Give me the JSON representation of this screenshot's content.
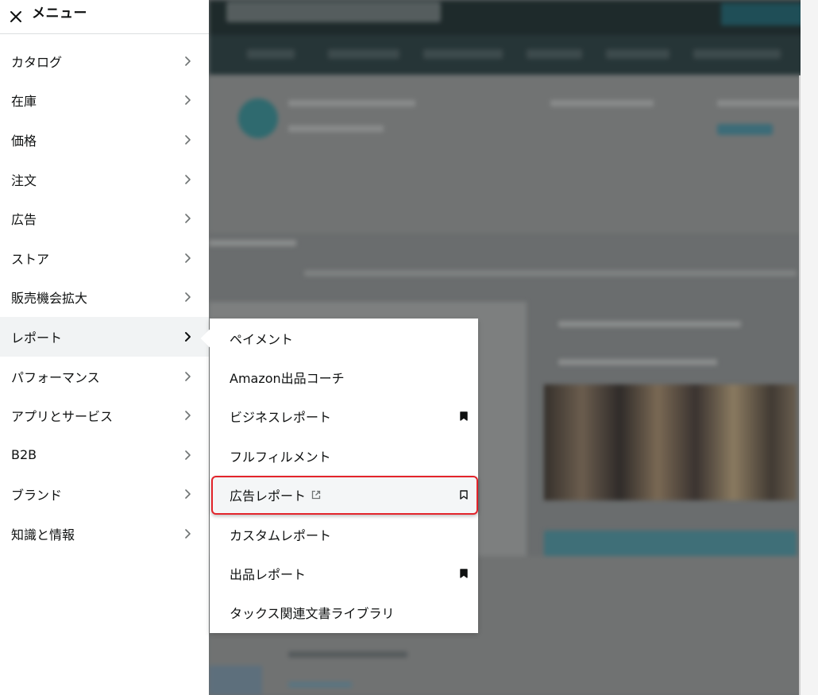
{
  "menu": {
    "title": "メニュー",
    "items": [
      {
        "label": "カタログ"
      },
      {
        "label": "在庫"
      },
      {
        "label": "価格"
      },
      {
        "label": "注文"
      },
      {
        "label": "広告"
      },
      {
        "label": "ストア"
      },
      {
        "label": "販売機会拡大"
      },
      {
        "label": "レポート",
        "active": true
      },
      {
        "label": "パフォーマンス"
      },
      {
        "label": "アプリとサービス"
      },
      {
        "label": "B2B"
      },
      {
        "label": "ブランド"
      },
      {
        "label": "知識と情報"
      }
    ]
  },
  "submenu": {
    "parent": "レポート",
    "items": [
      {
        "label": "ペイメント",
        "bookmark": "none",
        "external": false
      },
      {
        "label": "Amazon出品コーチ",
        "bookmark": "none",
        "external": false
      },
      {
        "label": "ビジネスレポート",
        "bookmark": "filled",
        "external": false
      },
      {
        "label": "フルフィルメント",
        "bookmark": "none",
        "external": false
      },
      {
        "label": "広告レポート",
        "bookmark": "outline",
        "external": true,
        "highlighted": true
      },
      {
        "label": "カスタムレポート",
        "bookmark": "none",
        "external": false
      },
      {
        "label": "出品レポート",
        "bookmark": "filled",
        "external": false
      },
      {
        "label": "タックス関連文書ライブラリ",
        "bookmark": "none",
        "external": false
      }
    ]
  },
  "colors": {
    "highlight_border": "#e3242b",
    "icon_dark": "#0f1111",
    "active_bg": "#f1f3f4"
  }
}
